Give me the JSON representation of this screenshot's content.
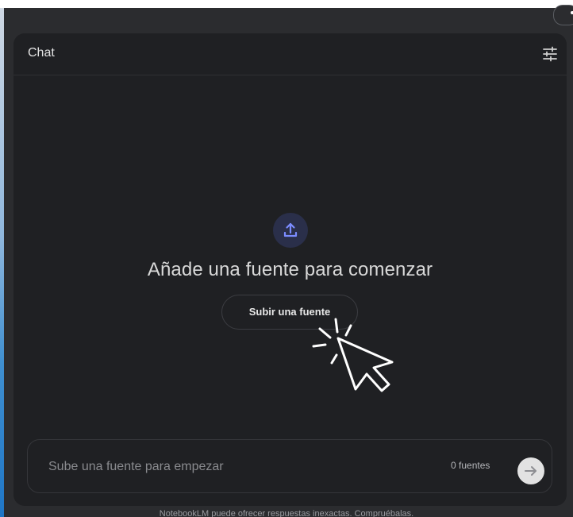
{
  "chat": {
    "title": "Chat",
    "settings_icon": "tune-sliders-icon"
  },
  "empty_state": {
    "icon": "upload-icon",
    "heading": "Añade una fuente para comenzar",
    "upload_button_label": "Subir una fuente"
  },
  "composer": {
    "placeholder": "Sube una fuente para empezar",
    "source_count": "0 fuentes",
    "send_icon": "arrow-right-icon"
  },
  "footer": {
    "note": "NotebookLM puede ofrecer respuestas inexactas. Compruébalas."
  },
  "colors": {
    "accent": "#8ab4f8",
    "upload_icon": "#7b8cff",
    "card_bg": "#1f2023"
  }
}
